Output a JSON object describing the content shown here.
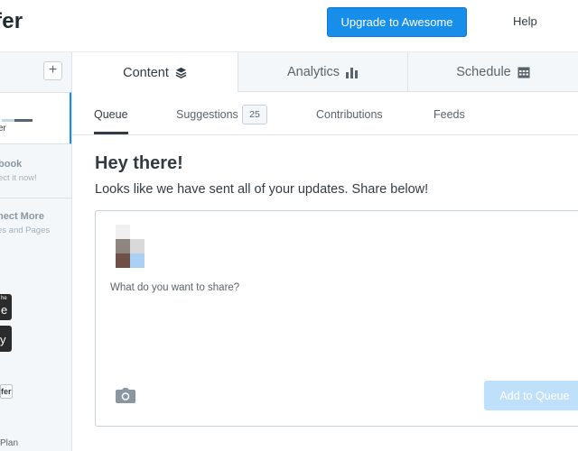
{
  "header": {
    "logo_text": "fer",
    "upgrade_label": "Upgrade to Awesome",
    "help_label": "Help"
  },
  "sidebar": {
    "add_label": "+",
    "profile_name": "er",
    "connect_facebook": {
      "title": "book",
      "subtitle": "ect it now!"
    },
    "connect_more": {
      "title": "nect More",
      "subtitle": "es and Pages"
    },
    "app_store": {
      "top_text": "he",
      "main_text": "e"
    },
    "google_play": {
      "main_text": "y"
    },
    "mini_badge_text": "fer",
    "plan_text": "Plan"
  },
  "main_tabs": [
    {
      "label": "Content",
      "icon": "layers-icon"
    },
    {
      "label": "Analytics",
      "icon": "bar-chart-icon"
    },
    {
      "label": "Schedule",
      "icon": "calendar-icon"
    }
  ],
  "sub_tabs": {
    "queue": "Queue",
    "suggestions": "Suggestions",
    "suggestions_count": "25",
    "contributions": "Contributions",
    "feeds": "Feeds"
  },
  "content": {
    "heading": "Hey there!",
    "subheading": "Looks like we have sent all of your updates. Share below!",
    "composer_placeholder": "What do you want to share?",
    "add_to_queue_label": "Add to Queue"
  },
  "colors": {
    "accent": "#168eea",
    "accent_disabled": "#bfe0fb",
    "text": "#323b43",
    "muted": "#59636b",
    "sidebar_bg": "#f4f7f9"
  }
}
